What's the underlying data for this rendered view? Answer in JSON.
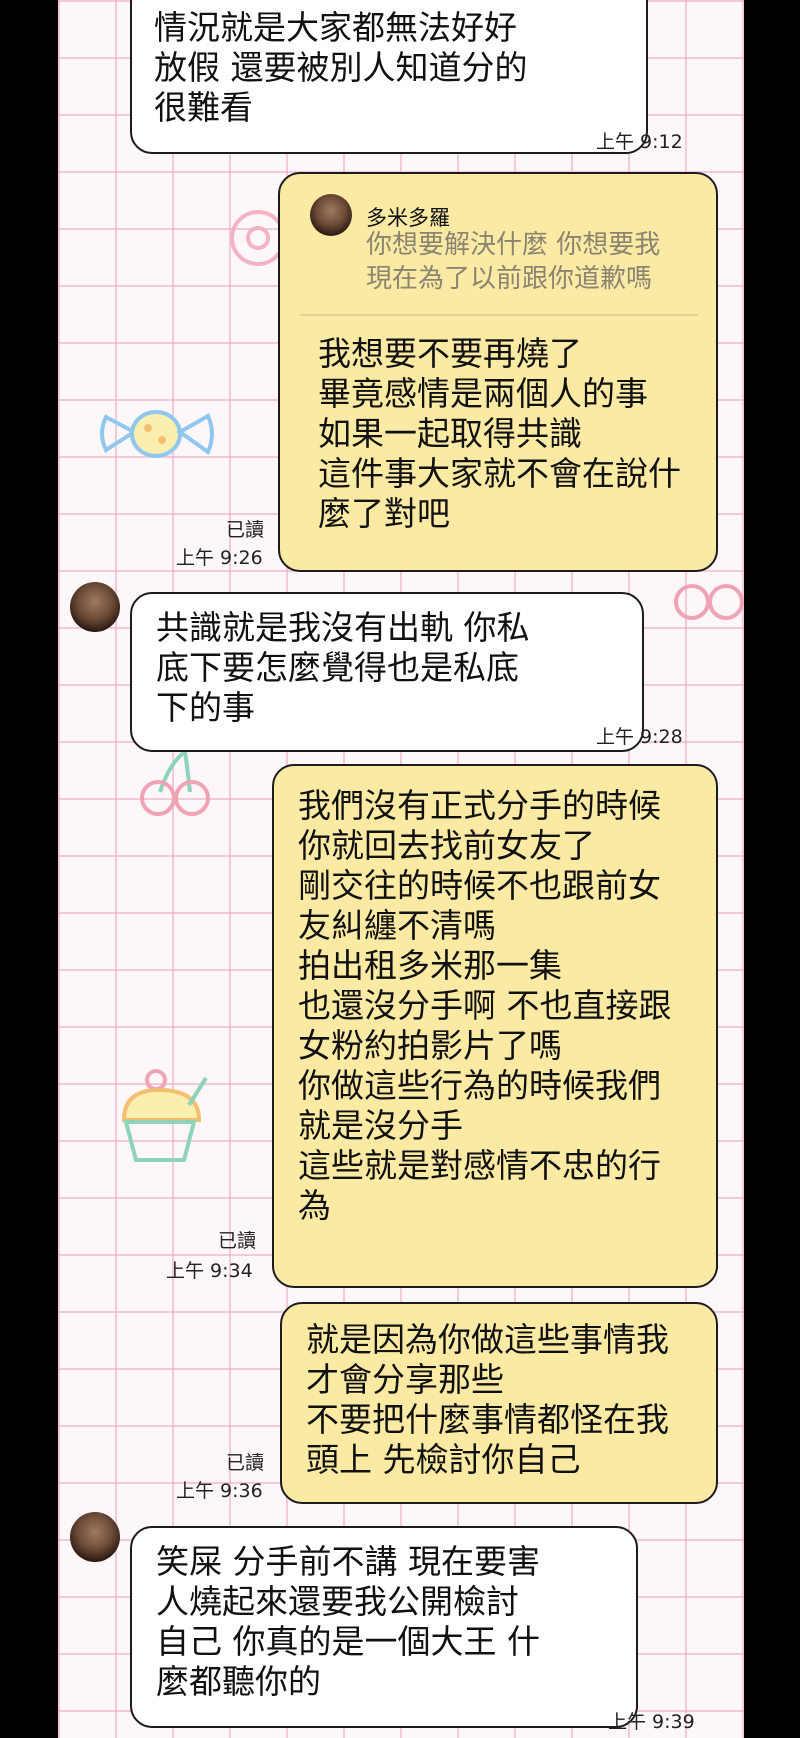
{
  "messages": [
    {
      "id": "m1",
      "side": "in",
      "lines": "情況就是大家都無法好好\n放假 還要被別人知道分的\n很難看",
      "time": "上午 9:12"
    },
    {
      "id": "m2",
      "side": "out",
      "quote": {
        "name": "多米多羅",
        "text": "你想要解決什麼 你想要我\n現在為了以前跟你道歉嗎"
      },
      "lines": "我想要不要再燒了\n畢竟感情是兩個人的事\n如果一起取得共識\n這件事大家就不會在說什\n麼了對吧",
      "read": "已讀",
      "time": "上午 9:26"
    },
    {
      "id": "m3",
      "side": "in",
      "lines": "共識就是我沒有出軌 你私\n底下要怎麼覺得也是私底\n下的事",
      "time": "上午 9:28"
    },
    {
      "id": "m4",
      "side": "out",
      "lines": "我們沒有正式分手的時候\n你就回去找前女友了\n剛交往的時候不也跟前女\n友糾纏不清嗎\n拍出租多米那一集\n也還沒分手啊 不也直接跟\n女粉約拍影片了嗎\n你做這些行為的時候我們\n就是沒分手\n這些就是對感情不忠的行\n為",
      "read": "已讀",
      "time": "上午 9:34"
    },
    {
      "id": "m5",
      "side": "out",
      "lines": "就是因為你做這些事情我\n才會分享那些\n不要把什麼事情都怪在我\n頭上 先檢討你自己",
      "read": "已讀",
      "time": "上午 9:36"
    },
    {
      "id": "m6",
      "side": "in",
      "lines": "笑屎 分手前不講 現在要害\n人燒起來還要我公開檢討\n自己 你真的是一個大王 什\n麼都聽你的",
      "time": "上午 9:39"
    }
  ],
  "colors": {
    "incoming_bubble": "#ffffff",
    "outgoing_bubble": "#fbeaa4",
    "grid": "#eca6ba",
    "background": "#fdf7f9"
  }
}
